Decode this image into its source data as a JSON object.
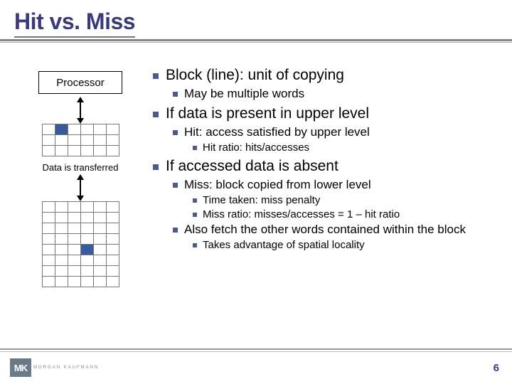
{
  "title": "Hit vs. Miss",
  "diagram": {
    "processor_label": "Processor",
    "transfer_label": "Data is transferred"
  },
  "bullets": {
    "l1a": "Block (line): unit of copying",
    "l1a_1": "May be multiple words",
    "l1b": "If data is present in upper level",
    "l1b_1": "Hit: access satisfied by upper level",
    "l1b_1_1": "Hit ratio: hits/accesses",
    "l1c": "If accessed data is absent",
    "l1c_1": "Miss: block copied from lower level",
    "l1c_1_1": "Time taken: miss penalty",
    "l1c_1_2": "Miss ratio: misses/accesses = 1 – hit ratio",
    "l1c_2": "Also fetch the other words contained within the block",
    "l1c_2_1": "Takes advantage of spatial locality"
  },
  "footer": {
    "logo_initials": "MK",
    "logo_text": "MORGAN KAUFMANN",
    "page_number": "6"
  }
}
